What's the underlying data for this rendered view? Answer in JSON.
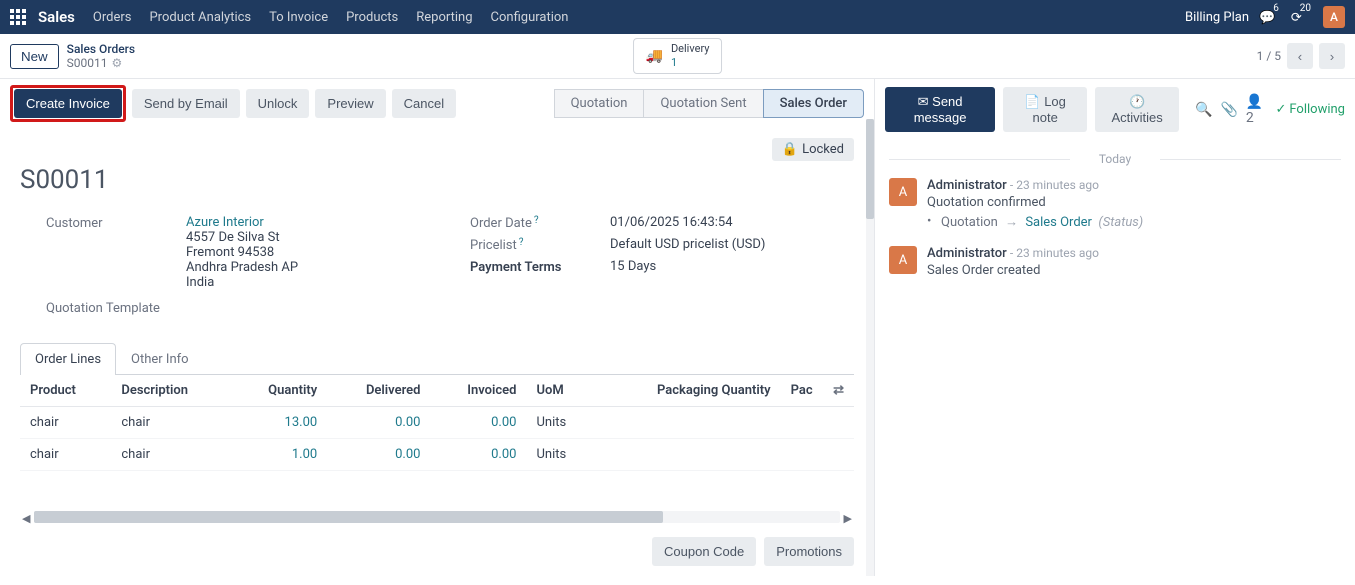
{
  "nav": {
    "brand": "Sales",
    "menu": [
      "Orders",
      "Product Analytics",
      "To Invoice",
      "Products",
      "Reporting",
      "Configuration"
    ],
    "billing_plan": "Billing Plan",
    "msg_count": "6",
    "activity_count": "20",
    "avatar": "A"
  },
  "control": {
    "new_label": "New",
    "crumb_title": "Sales Orders",
    "crumb_id": "S00011",
    "delivery_label": "Delivery",
    "delivery_count": "1",
    "pager": "1 / 5"
  },
  "status": {
    "create_invoice": "Create Invoice",
    "send_email": "Send by Email",
    "unlock": "Unlock",
    "preview": "Preview",
    "cancel": "Cancel",
    "stages": [
      "Quotation",
      "Quotation Sent",
      "Sales Order"
    ],
    "locked": "Locked"
  },
  "form": {
    "order_id": "S00011",
    "customer_label": "Customer",
    "customer_name": "Azure Interior",
    "addr1": "4557 De Silva St",
    "addr2": "Fremont 94538",
    "addr3": "Andhra Pradesh AP",
    "addr4": "India",
    "quotation_template_label": "Quotation Template",
    "order_date_label": "Order Date",
    "order_date": "01/06/2025 16:43:54",
    "pricelist_label": "Pricelist",
    "pricelist": "Default USD pricelist (USD)",
    "payment_terms_label": "Payment Terms",
    "payment_terms": "15 Days"
  },
  "tabs": {
    "order_lines": "Order Lines",
    "other_info": "Other Info"
  },
  "table": {
    "headers": {
      "product": "Product",
      "description": "Description",
      "quantity": "Quantity",
      "delivered": "Delivered",
      "invoiced": "Invoiced",
      "uom": "UoM",
      "pkg_qty": "Packaging Quantity",
      "pac": "Pac"
    },
    "rows": [
      {
        "product": "chair",
        "description": "chair",
        "quantity": "13.00",
        "delivered": "0.00",
        "invoiced": "0.00",
        "uom": "Units"
      },
      {
        "product": "chair",
        "description": "chair",
        "quantity": "1.00",
        "delivered": "0.00",
        "invoiced": "0.00",
        "uom": "Units"
      }
    ]
  },
  "footer": {
    "coupon": "Coupon Code",
    "promotions": "Promotions"
  },
  "chatter": {
    "send_message": "Send message",
    "log_note": "Log note",
    "activities": "Activities",
    "follower_count": "2",
    "following": "Following",
    "today": "Today",
    "messages": [
      {
        "author": "Administrator",
        "time": "23 minutes ago",
        "body": "Quotation confirmed",
        "sub_label": "Quotation",
        "sub_target": "Sales Order",
        "sub_status": "(Status)"
      },
      {
        "author": "Administrator",
        "time": "23 minutes ago",
        "body": "Sales Order created"
      }
    ]
  }
}
